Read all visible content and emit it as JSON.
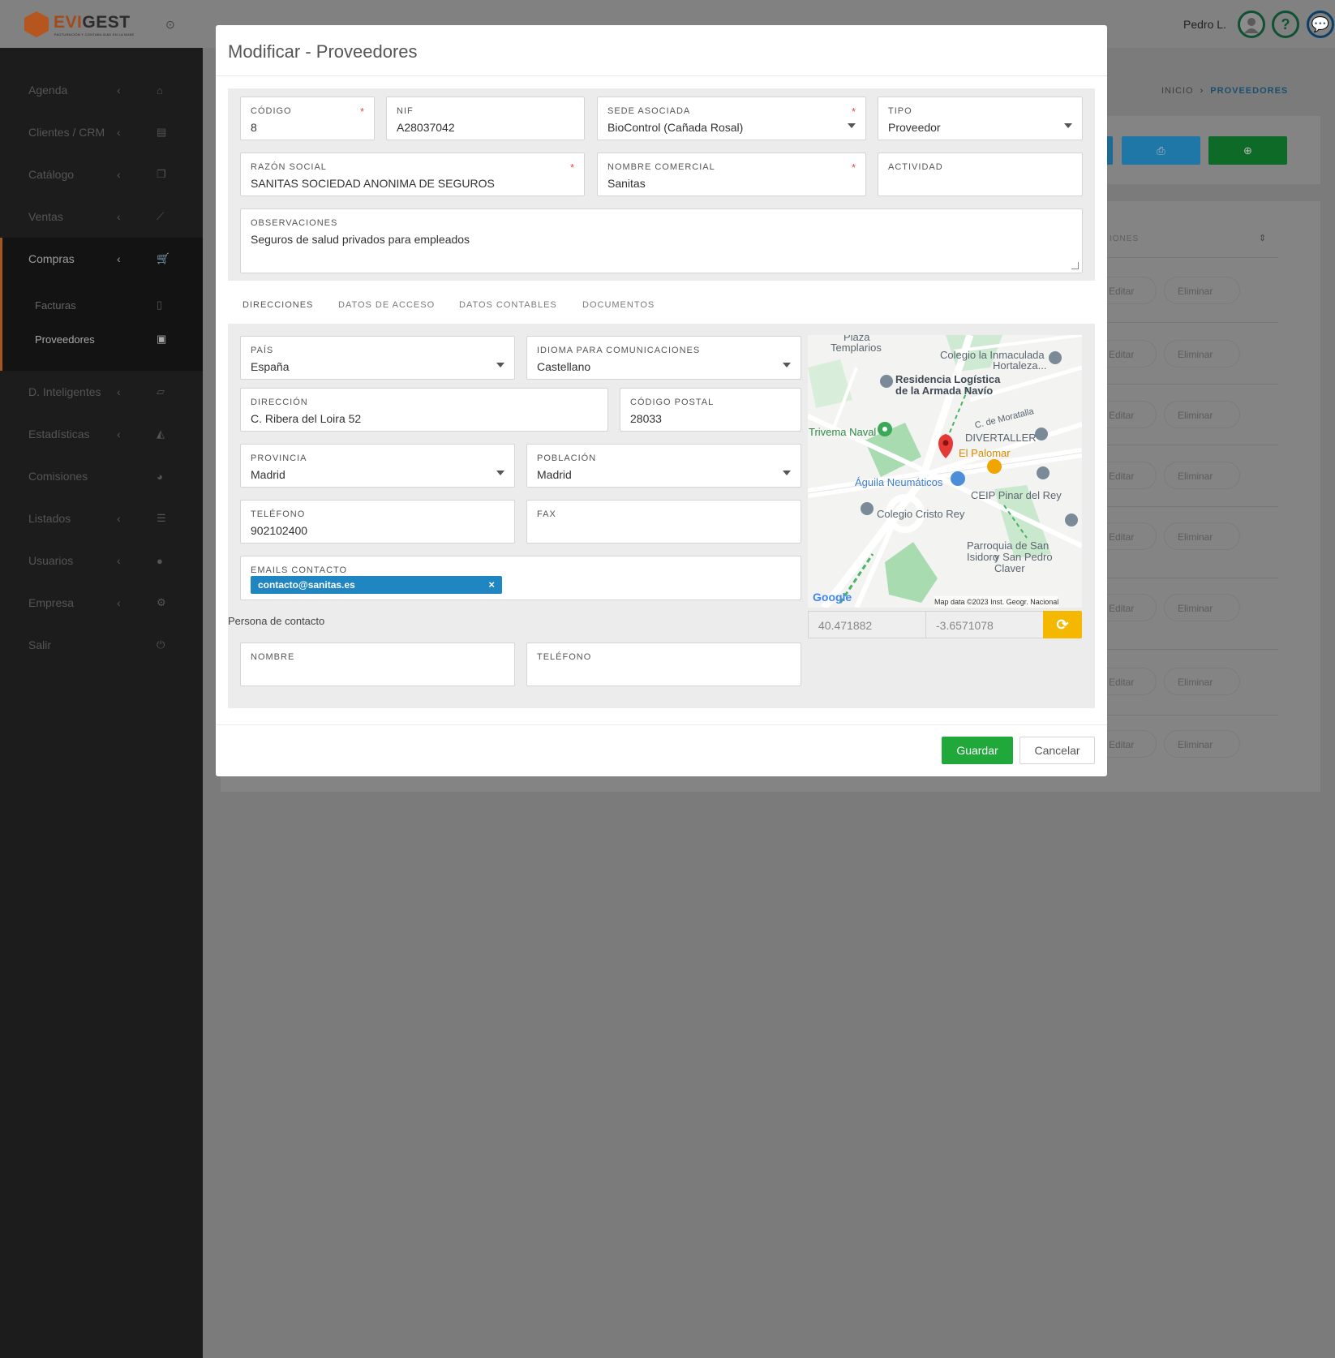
{
  "app": {
    "brand_part1": "EVI",
    "brand_part2": "GEST",
    "tagline": "FACTURACIÓN Y CONTABILIDAD EN LA NUBE"
  },
  "topbar": {
    "user_name": "Pedro L.",
    "help_glyph": "?"
  },
  "sidebar": {
    "items": [
      {
        "label": "Agenda",
        "icon": "home-icon"
      },
      {
        "label": "Clientes / CRM",
        "icon": "id-card-icon"
      },
      {
        "label": "Catálogo",
        "icon": "copy-icon"
      },
      {
        "label": "Ventas",
        "icon": "chart-line-icon"
      },
      {
        "label": "Compras",
        "icon": "cart-icon"
      },
      {
        "label": "D. Inteligentes",
        "icon": "folder-open-icon"
      },
      {
        "label": "Estadísticas",
        "icon": "area-chart-icon"
      },
      {
        "label": "Comisiones",
        "icon": "pie-chart-icon"
      },
      {
        "label": "Listados",
        "icon": "list-icon"
      },
      {
        "label": "Usuarios",
        "icon": "user-icon"
      },
      {
        "label": "Empresa",
        "icon": "gear-icon"
      },
      {
        "label": "Salir",
        "icon": "power-icon"
      }
    ],
    "compras_sub": [
      {
        "label": "Facturas",
        "icon": "file-icon"
      },
      {
        "label": "Proveedores",
        "icon": "address-card-icon"
      }
    ]
  },
  "background": {
    "breadcrumb_home": "INICIO",
    "breadcrumb_current": "PROVEEDORES",
    "table_header": "IONES",
    "edit_label": "Editar",
    "delete_label": "Eliminar"
  },
  "modal": {
    "title": "Modificar - Proveedores",
    "codigo": {
      "label": "CÓDIGO",
      "value": "8"
    },
    "nif": {
      "label": "NIF",
      "value": "A28037042"
    },
    "sede": {
      "label": "SEDE ASOCIADA",
      "value": "BioControl (Cañada Rosal)"
    },
    "tipo": {
      "label": "TIPO",
      "value": "Proveedor"
    },
    "razon_social": {
      "label": "RAZÓN SOCIAL",
      "value": "SANITAS SOCIEDAD ANONIMA DE SEGUROS"
    },
    "nombre_comercial": {
      "label": "NOMBRE COMERCIAL",
      "value": "Sanitas"
    },
    "actividad": {
      "label": "ACTIVIDAD",
      "value": ""
    },
    "observaciones": {
      "label": "OBSERVACIONES",
      "value": "Seguros de salud privados para empleados"
    },
    "tabs": [
      "DIRECCIONES",
      "DATOS DE ACCESO",
      "DATOS CONTABLES",
      "DOCUMENTOS"
    ],
    "pais": {
      "label": "PAÍS",
      "value": "España"
    },
    "idioma": {
      "label": "IDIOMA PARA COMUNICACIONES",
      "value": "Castellano"
    },
    "direccion": {
      "label": "DIRECCIÓN",
      "value": "C. Ribera del Loira 52"
    },
    "codigo_postal": {
      "label": "CÓDIGO POSTAL",
      "value": "28033"
    },
    "provincia": {
      "label": "PROVINCIA",
      "value": "Madrid"
    },
    "poblacion": {
      "label": "POBLACIÓN",
      "value": "Madrid"
    },
    "telefono": {
      "label": "TELÉFONO",
      "value": "902102400"
    },
    "fax": {
      "label": "FAX",
      "value": ""
    },
    "emails": {
      "label": "EMAILS CONTACTO",
      "tags": [
        "contacto@sanitas.es"
      ]
    },
    "contact_caption": "Persona de contacto",
    "contacto_nombre": {
      "label": "NOMBRE",
      "value": ""
    },
    "contacto_telefono": {
      "label": "TELÉFONO",
      "value": ""
    },
    "map": {
      "labels": {
        "plaza": "Plaza",
        "templarios": "Templarios",
        "colegio1": "Colegio la Inmaculada",
        "colegio2": "Hortaleza...",
        "residencia1": "Residencia Logística",
        "residencia2": "de la Armada Navío",
        "moratalla": "C. de Moratalla",
        "trivema": "Trivema Naval",
        "divertaller": "DIVERTALLER",
        "palomar": "El Palomar",
        "aguila": "Águila Neumáticos",
        "ceip": "CEIP Pinar del Rey",
        "cristo": "Colegio Cristo Rey",
        "parroquia1": "Parroquia de San Isidoro",
        "parroquia2": "y San Pedro Claver",
        "google": "Google",
        "attribution": "Map data ©2023 Inst. Geogr. Nacional"
      },
      "lat": "40.471882",
      "lng": "-3.6571078"
    },
    "save_label": "Guardar",
    "cancel_label": "Cancelar"
  }
}
